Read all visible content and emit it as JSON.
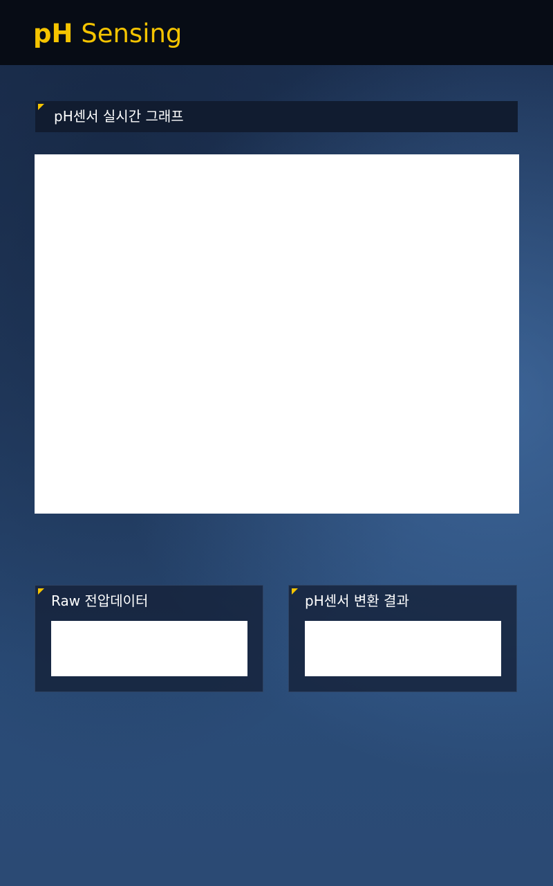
{
  "header": {
    "title_bold": "pH",
    "title_rest": " Sensing",
    "accent_color": "#f5c400"
  },
  "graph_section": {
    "title": "pH센서 실시간 그래프"
  },
  "panels": {
    "raw_voltage": {
      "title": "Raw 전압데이터",
      "value": ""
    },
    "ph_result": {
      "title": "pH센서 변환 결과",
      "value": ""
    }
  }
}
